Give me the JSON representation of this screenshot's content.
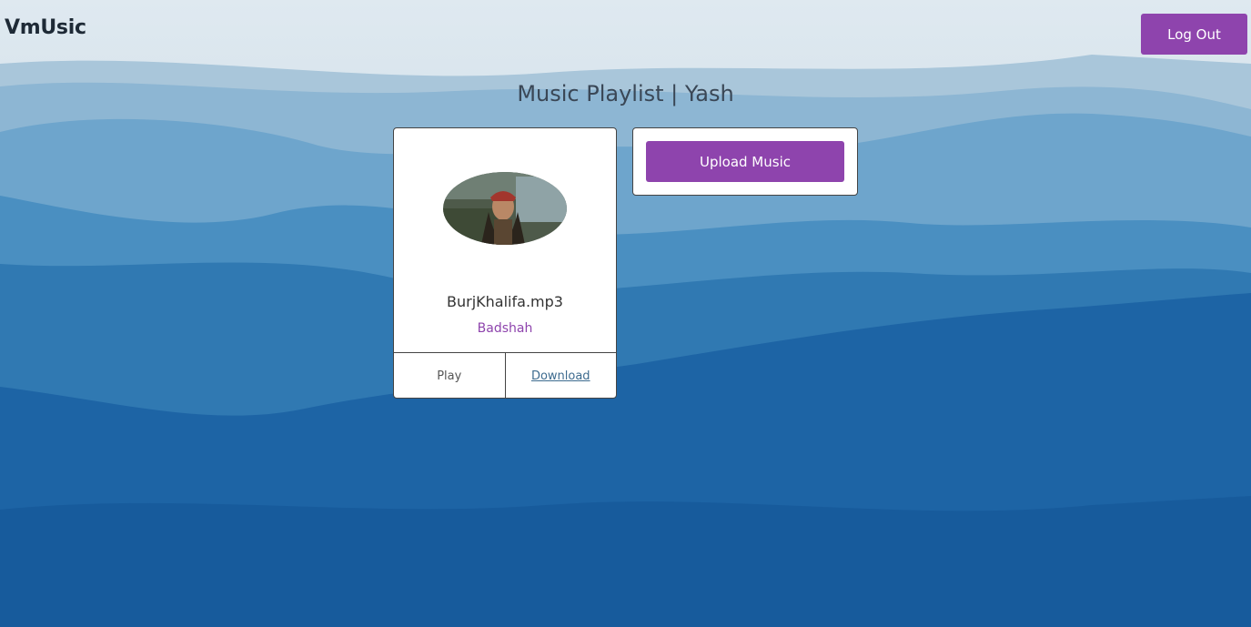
{
  "header": {
    "brand": "VmUsic",
    "logout_label": "Log Out"
  },
  "page": {
    "title": "Music Playlist | Yash"
  },
  "songs": [
    {
      "title": "BurjKhalifa.mp3",
      "artist": "Badshah",
      "play_label": "Play",
      "download_label": "Download"
    }
  ],
  "upload": {
    "label": "Upload Music"
  },
  "colors": {
    "accent": "#8e44ad",
    "background_top": "#d6e3ec",
    "background_bottom": "#1a5a97"
  },
  "icons": {
    "background": "mountain-landscape-image",
    "album_art": "album-art-image"
  }
}
